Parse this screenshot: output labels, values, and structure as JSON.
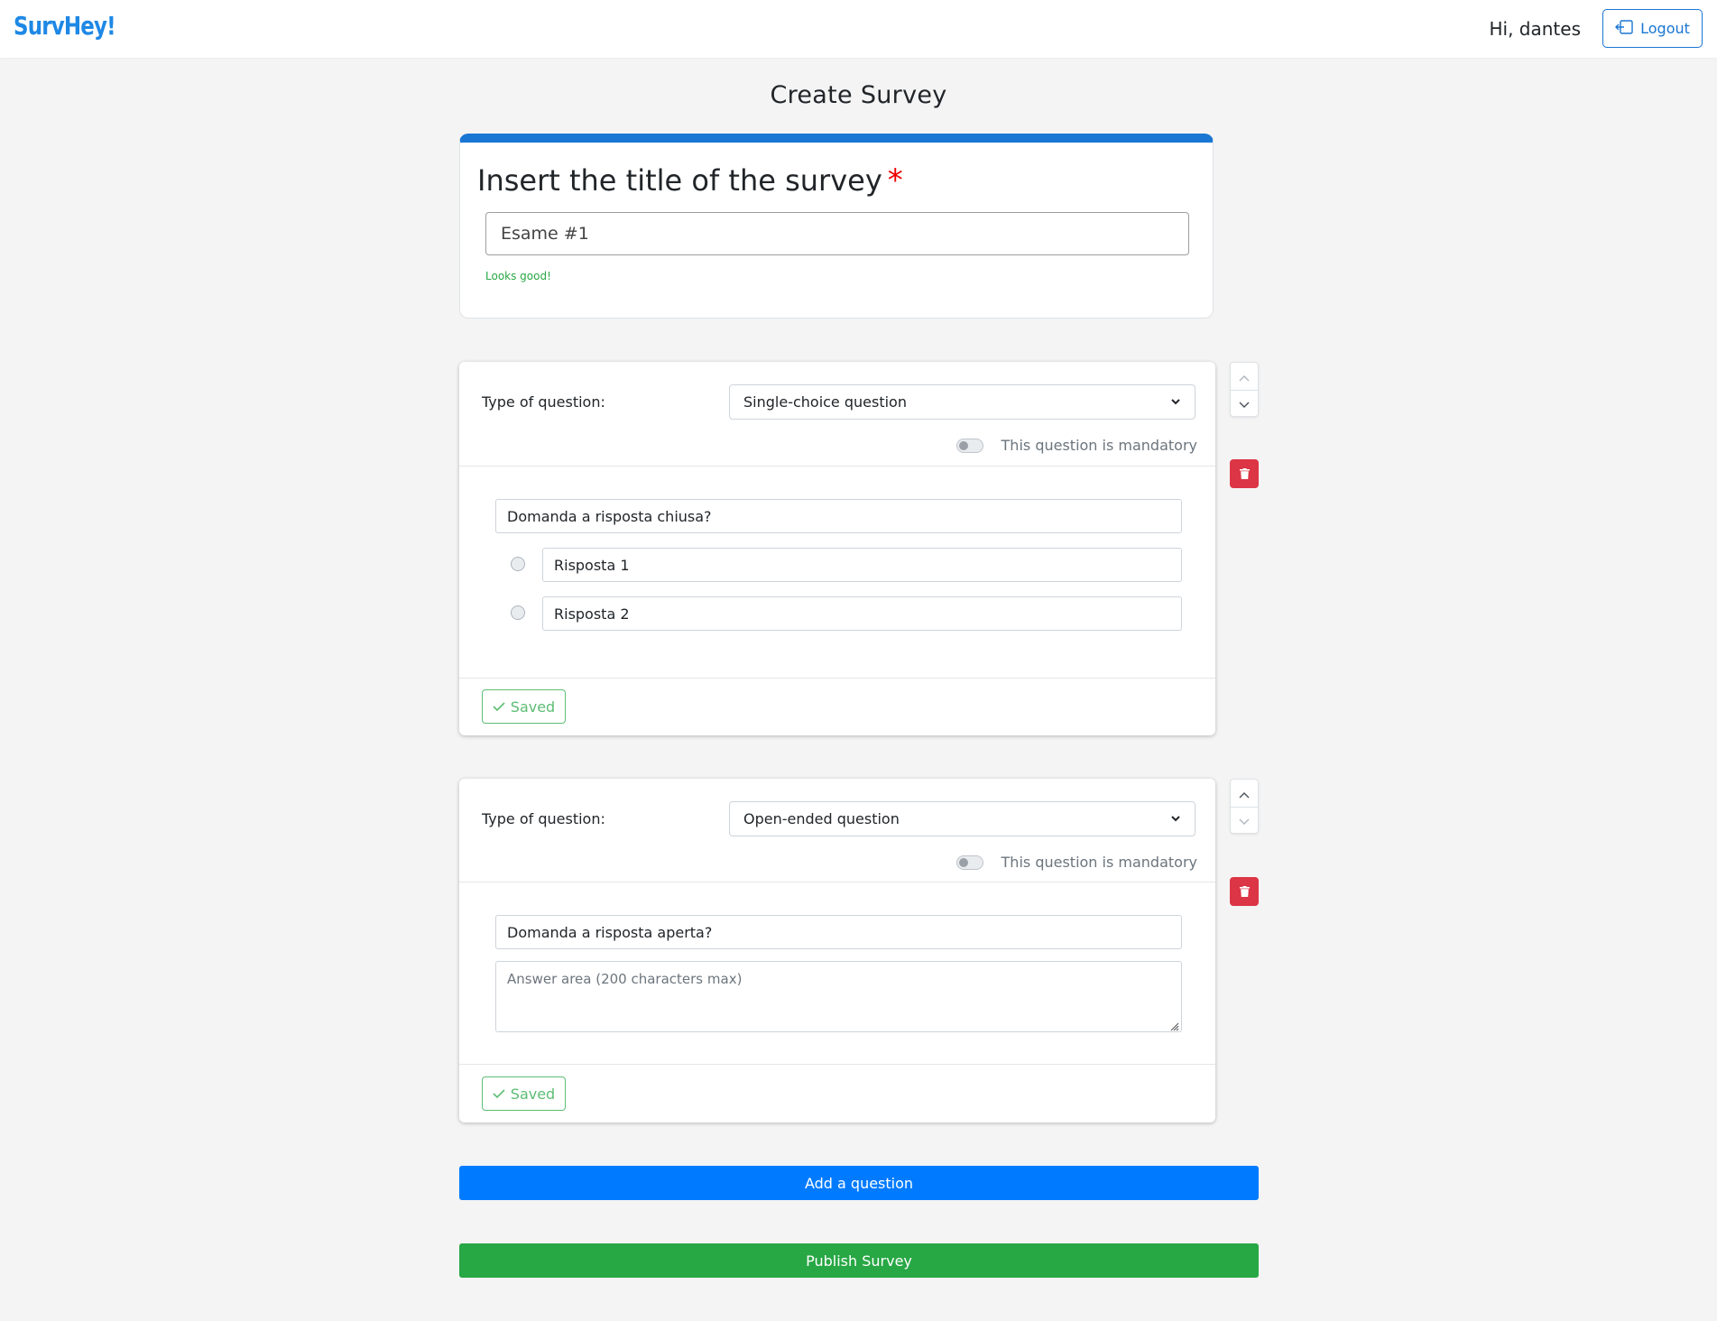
{
  "navbar": {
    "brand": "SurvHey!",
    "greeting": "Hi, dantes",
    "logout_label": "Logout"
  },
  "page": {
    "title": "Create Survey"
  },
  "title_card": {
    "heading": "Insert the title of the survey",
    "required_mark": "*",
    "title_value": "Esame #1",
    "validation_message": "Looks good!"
  },
  "questions": [
    {
      "type_label": "Type of question:",
      "type_value": "Single-choice question",
      "mandatory_label": "This question is mandatory",
      "mandatory": false,
      "question_text": "Domanda a risposta chiusa?",
      "answers": [
        "Risposta 1",
        "Risposta 2"
      ],
      "saved_label": "Saved"
    },
    {
      "type_label": "Type of question:",
      "type_value": "Open-ended question",
      "mandatory_label": "This question is mandatory",
      "mandatory": false,
      "question_text": "Domanda a risposta aperta?",
      "answer_placeholder": "Answer area (200 characters max)",
      "saved_label": "Saved"
    }
  ],
  "actions": {
    "add_question_label": "Add a question",
    "publish_label": "Publish Survey"
  },
  "colors": {
    "brand": "#1e88e5",
    "primary": "#007bff",
    "success": "#28a745",
    "danger": "#dc3545",
    "accent_border": "#1976d2"
  }
}
